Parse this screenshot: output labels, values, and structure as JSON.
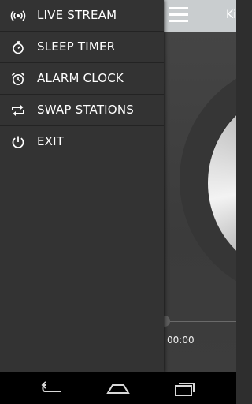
{
  "app": {
    "title_partial": "Ki",
    "elapsed_time": "00:00"
  },
  "drawer": {
    "items": [
      {
        "label": "LIVE STREAM",
        "icon": "broadcast-icon"
      },
      {
        "label": "SLEEP TIMER",
        "icon": "stopwatch-icon"
      },
      {
        "label": "ALARM CLOCK",
        "icon": "alarm-clock-icon"
      },
      {
        "label": "SWAP STATIONS",
        "icon": "swap-arrows-icon"
      },
      {
        "label": "EXIT",
        "icon": "power-icon"
      }
    ]
  },
  "navbar": {
    "buttons": [
      "back-icon",
      "home-icon",
      "recent-apps-icon"
    ]
  },
  "colors": {
    "drawer_bg": "#333333",
    "header_bg": "#c9cdcf",
    "navbar_bg": "#000000",
    "text": "#ffffff"
  }
}
